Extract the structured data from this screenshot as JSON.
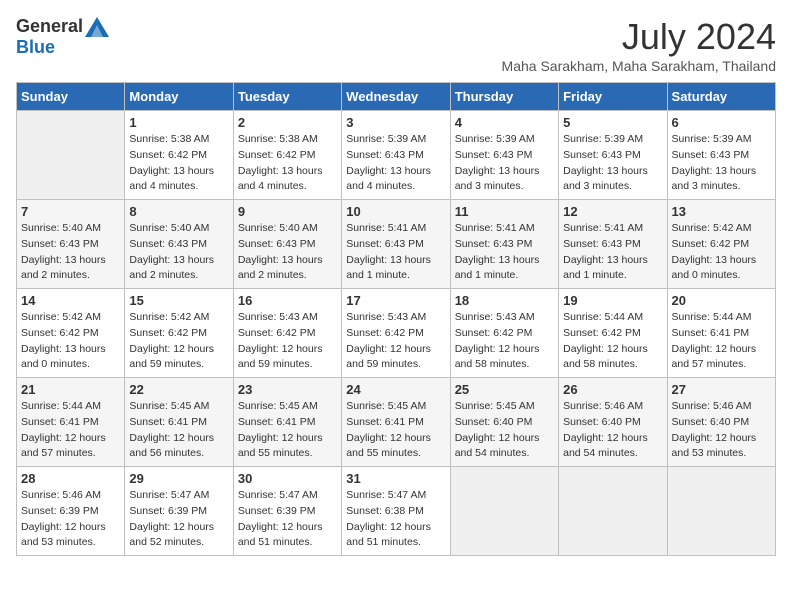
{
  "header": {
    "logo": {
      "general": "General",
      "blue": "Blue"
    },
    "title": "July 2024",
    "location": "Maha Sarakham, Maha Sarakham, Thailand"
  },
  "days_of_week": [
    "Sunday",
    "Monday",
    "Tuesday",
    "Wednesday",
    "Thursday",
    "Friday",
    "Saturday"
  ],
  "weeks": [
    [
      {
        "day": "",
        "info": ""
      },
      {
        "day": "1",
        "info": "Sunrise: 5:38 AM\nSunset: 6:42 PM\nDaylight: 13 hours\nand 4 minutes."
      },
      {
        "day": "2",
        "info": "Sunrise: 5:38 AM\nSunset: 6:42 PM\nDaylight: 13 hours\nand 4 minutes."
      },
      {
        "day": "3",
        "info": "Sunrise: 5:39 AM\nSunset: 6:43 PM\nDaylight: 13 hours\nand 4 minutes."
      },
      {
        "day": "4",
        "info": "Sunrise: 5:39 AM\nSunset: 6:43 PM\nDaylight: 13 hours\nand 3 minutes."
      },
      {
        "day": "5",
        "info": "Sunrise: 5:39 AM\nSunset: 6:43 PM\nDaylight: 13 hours\nand 3 minutes."
      },
      {
        "day": "6",
        "info": "Sunrise: 5:39 AM\nSunset: 6:43 PM\nDaylight: 13 hours\nand 3 minutes."
      }
    ],
    [
      {
        "day": "7",
        "info": "Sunrise: 5:40 AM\nSunset: 6:43 PM\nDaylight: 13 hours\nand 2 minutes."
      },
      {
        "day": "8",
        "info": "Sunrise: 5:40 AM\nSunset: 6:43 PM\nDaylight: 13 hours\nand 2 minutes."
      },
      {
        "day": "9",
        "info": "Sunrise: 5:40 AM\nSunset: 6:43 PM\nDaylight: 13 hours\nand 2 minutes."
      },
      {
        "day": "10",
        "info": "Sunrise: 5:41 AM\nSunset: 6:43 PM\nDaylight: 13 hours\nand 1 minute."
      },
      {
        "day": "11",
        "info": "Sunrise: 5:41 AM\nSunset: 6:43 PM\nDaylight: 13 hours\nand 1 minute."
      },
      {
        "day": "12",
        "info": "Sunrise: 5:41 AM\nSunset: 6:43 PM\nDaylight: 13 hours\nand 1 minute."
      },
      {
        "day": "13",
        "info": "Sunrise: 5:42 AM\nSunset: 6:42 PM\nDaylight: 13 hours\nand 0 minutes."
      }
    ],
    [
      {
        "day": "14",
        "info": "Sunrise: 5:42 AM\nSunset: 6:42 PM\nDaylight: 13 hours\nand 0 minutes."
      },
      {
        "day": "15",
        "info": "Sunrise: 5:42 AM\nSunset: 6:42 PM\nDaylight: 12 hours\nand 59 minutes."
      },
      {
        "day": "16",
        "info": "Sunrise: 5:43 AM\nSunset: 6:42 PM\nDaylight: 12 hours\nand 59 minutes."
      },
      {
        "day": "17",
        "info": "Sunrise: 5:43 AM\nSunset: 6:42 PM\nDaylight: 12 hours\nand 59 minutes."
      },
      {
        "day": "18",
        "info": "Sunrise: 5:43 AM\nSunset: 6:42 PM\nDaylight: 12 hours\nand 58 minutes."
      },
      {
        "day": "19",
        "info": "Sunrise: 5:44 AM\nSunset: 6:42 PM\nDaylight: 12 hours\nand 58 minutes."
      },
      {
        "day": "20",
        "info": "Sunrise: 5:44 AM\nSunset: 6:41 PM\nDaylight: 12 hours\nand 57 minutes."
      }
    ],
    [
      {
        "day": "21",
        "info": "Sunrise: 5:44 AM\nSunset: 6:41 PM\nDaylight: 12 hours\nand 57 minutes."
      },
      {
        "day": "22",
        "info": "Sunrise: 5:45 AM\nSunset: 6:41 PM\nDaylight: 12 hours\nand 56 minutes."
      },
      {
        "day": "23",
        "info": "Sunrise: 5:45 AM\nSunset: 6:41 PM\nDaylight: 12 hours\nand 55 minutes."
      },
      {
        "day": "24",
        "info": "Sunrise: 5:45 AM\nSunset: 6:41 PM\nDaylight: 12 hours\nand 55 minutes."
      },
      {
        "day": "25",
        "info": "Sunrise: 5:45 AM\nSunset: 6:40 PM\nDaylight: 12 hours\nand 54 minutes."
      },
      {
        "day": "26",
        "info": "Sunrise: 5:46 AM\nSunset: 6:40 PM\nDaylight: 12 hours\nand 54 minutes."
      },
      {
        "day": "27",
        "info": "Sunrise: 5:46 AM\nSunset: 6:40 PM\nDaylight: 12 hours\nand 53 minutes."
      }
    ],
    [
      {
        "day": "28",
        "info": "Sunrise: 5:46 AM\nSunset: 6:39 PM\nDaylight: 12 hours\nand 53 minutes."
      },
      {
        "day": "29",
        "info": "Sunrise: 5:47 AM\nSunset: 6:39 PM\nDaylight: 12 hours\nand 52 minutes."
      },
      {
        "day": "30",
        "info": "Sunrise: 5:47 AM\nSunset: 6:39 PM\nDaylight: 12 hours\nand 51 minutes."
      },
      {
        "day": "31",
        "info": "Sunrise: 5:47 AM\nSunset: 6:38 PM\nDaylight: 12 hours\nand 51 minutes."
      },
      {
        "day": "",
        "info": ""
      },
      {
        "day": "",
        "info": ""
      },
      {
        "day": "",
        "info": ""
      }
    ]
  ]
}
